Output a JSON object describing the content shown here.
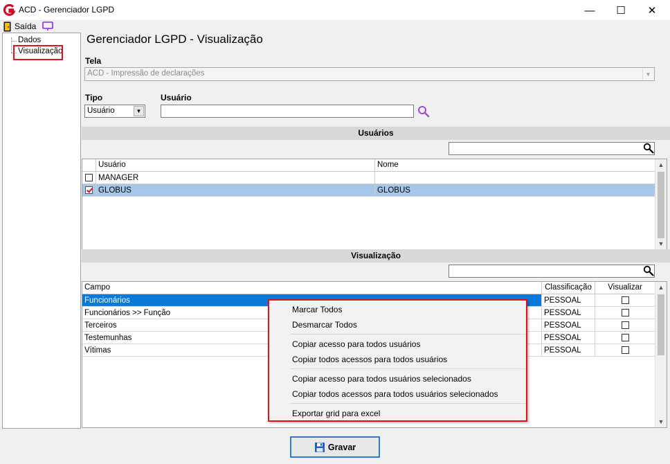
{
  "window": {
    "title": "ACD - Gerenciador LGPD",
    "minimize": "—",
    "maximize": "☐",
    "close": "✕"
  },
  "menu": {
    "exit_label": "Saída"
  },
  "tree": {
    "items": [
      {
        "label": "Dados"
      },
      {
        "label": "Visualização"
      }
    ]
  },
  "main": {
    "title": "Gerenciador LGPD - Visualização",
    "tela_label": "Tela",
    "tela_value": "ACD - Impressão de declarações",
    "tipo_label": "Tipo",
    "tipo_value": "Usuário",
    "usuario_label": "Usuário",
    "usuario_value": ""
  },
  "users_section": {
    "title": "Usuários",
    "columns": [
      "Usuário",
      "Nome"
    ],
    "rows": [
      {
        "checked": false,
        "usuario": "MANAGER",
        "nome": ""
      },
      {
        "checked": true,
        "usuario": "GLOBUS",
        "nome": "GLOBUS"
      }
    ]
  },
  "visual_section": {
    "title": "Visualização",
    "columns": [
      "Campo",
      "Classificação",
      "Visualizar"
    ],
    "rows": [
      {
        "campo": "Funcionários",
        "classificacao": "PESSOAL",
        "visualizar": false
      },
      {
        "campo": "Funcionários >> Função",
        "classificacao": "PESSOAL",
        "visualizar": false
      },
      {
        "campo": "Terceiros",
        "classificacao": "PESSOAL",
        "visualizar": false
      },
      {
        "campo": "Testemunhas",
        "classificacao": "PESSOAL",
        "visualizar": false
      },
      {
        "campo": "Vítimas",
        "classificacao": "PESSOAL",
        "visualizar": false
      }
    ]
  },
  "context_menu": {
    "items": [
      "Marcar Todos",
      "Desmarcar Todos",
      "Copiar acesso para todos usuários",
      "Copiar todos acessos para todos usuários",
      "Copiar acesso para todos usuários selecionados",
      "Copiar todos acessos para todos usuários selecionados",
      "Exportar grid para excel"
    ]
  },
  "footer": {
    "save_label": "Gravar"
  },
  "colors": {
    "accent": "#0a78d7",
    "highlight": "#e0111b",
    "selected_row": "#a8c6e8",
    "section_bar": "#d8d8d8"
  }
}
